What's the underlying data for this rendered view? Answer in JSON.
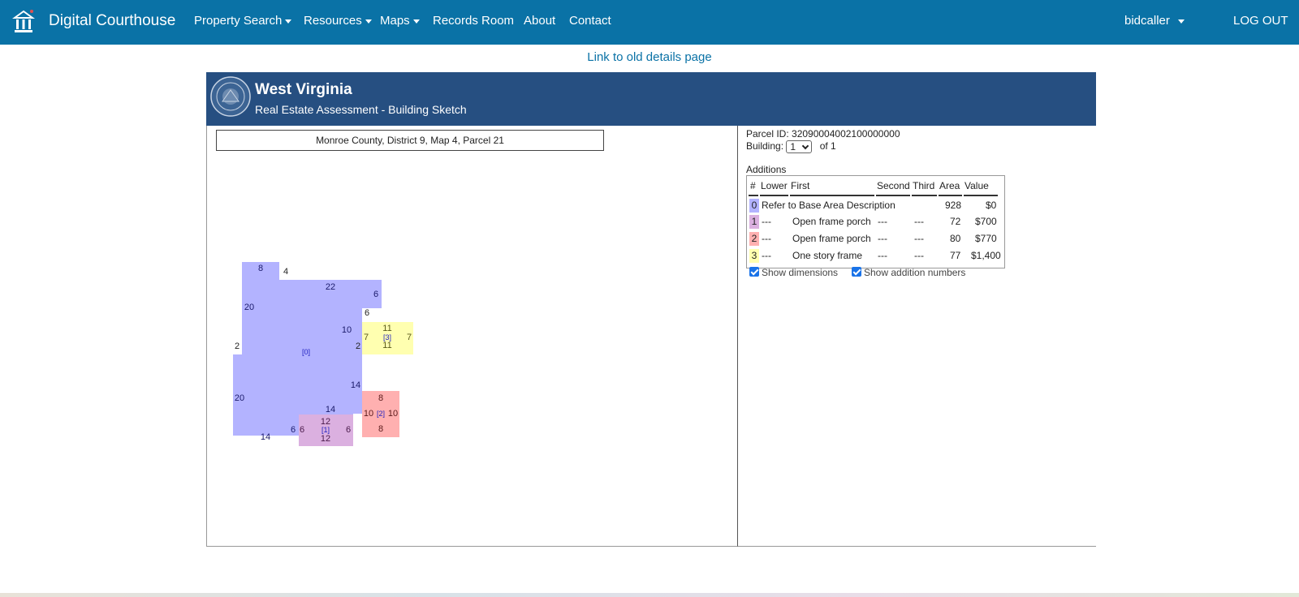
{
  "navbar": {
    "brand": "Digital Courthouse",
    "items": [
      {
        "label": "Property Search",
        "dropdown": true
      },
      {
        "label": "Resources",
        "dropdown": true
      },
      {
        "label": "Maps",
        "dropdown": true
      },
      {
        "label": "Records Room",
        "dropdown": false
      },
      {
        "label": "About",
        "dropdown": false
      },
      {
        "label": "Contact",
        "dropdown": false
      }
    ],
    "user": "bidcaller",
    "logout": "LOG OUT"
  },
  "old_details_link": "Link to old details page",
  "panel": {
    "title": "West Virginia",
    "subtitle": "Real Estate Assessment - Building Sketch",
    "parcel_label": "Monroe County, District 9, Map 4, Parcel 21"
  },
  "info": {
    "parcel_id": "Parcel ID: 32090004002100000000",
    "building_label": "Building:",
    "building_value": "1",
    "building_of": "of 1",
    "additions_label": "Additions",
    "table": {
      "headers": [
        "#",
        "Lower",
        "First",
        "Second",
        "Third",
        "Area",
        "Value"
      ],
      "rows": [
        {
          "num": "0",
          "color": "#b3b3ff",
          "lower": "Refer to Base Area Description",
          "first": "",
          "second": "",
          "third": "",
          "area": "928",
          "value": "$0"
        },
        {
          "num": "1",
          "color": "#dbb0e0",
          "lower": "---",
          "first": "Open frame porch",
          "second": "---",
          "third": "---",
          "area": "72",
          "value": "$700"
        },
        {
          "num": "2",
          "color": "#ffb0b0",
          "lower": "---",
          "first": "Open frame porch",
          "second": "---",
          "third": "---",
          "area": "80",
          "value": "$770"
        },
        {
          "num": "3",
          "color": "#ffffb0",
          "lower": "---",
          "first": "One story frame",
          "second": "---",
          "third": "---",
          "area": "77",
          "value": "$1,400"
        }
      ]
    },
    "show_dimensions": "Show dimensions",
    "show_addition_numbers": "Show addition numbers"
  },
  "sketch": {
    "colors": {
      "base": "#b3b3ff",
      "porch1": "#dbb0e0",
      "porch2": "#ffb0b0",
      "frame3": "#ffffb0"
    },
    "labels": {
      "base_id": "[0]",
      "a1_id": "[1]",
      "a2_id": "[2]",
      "a3_id": "[3]",
      "d8": "8",
      "d4": "4",
      "d22": "22",
      "d6a": "6",
      "d20a": "20",
      "d6b": "6",
      "d10a": "10",
      "d2a": "2",
      "d2b": "2",
      "d14a": "14",
      "d20b": "20",
      "d14b": "14",
      "d14c": "14",
      "d6c": "6",
      "a1_top": "12",
      "a1_bottom": "12",
      "a1_left": "6",
      "a1_right": "6",
      "a2_top": "8",
      "a2_bottom": "8",
      "a2_left": "10",
      "a2_right": "10",
      "a3_top": "11",
      "a3_bottom": "11",
      "a3_left": "7",
      "a3_right": "7"
    }
  }
}
